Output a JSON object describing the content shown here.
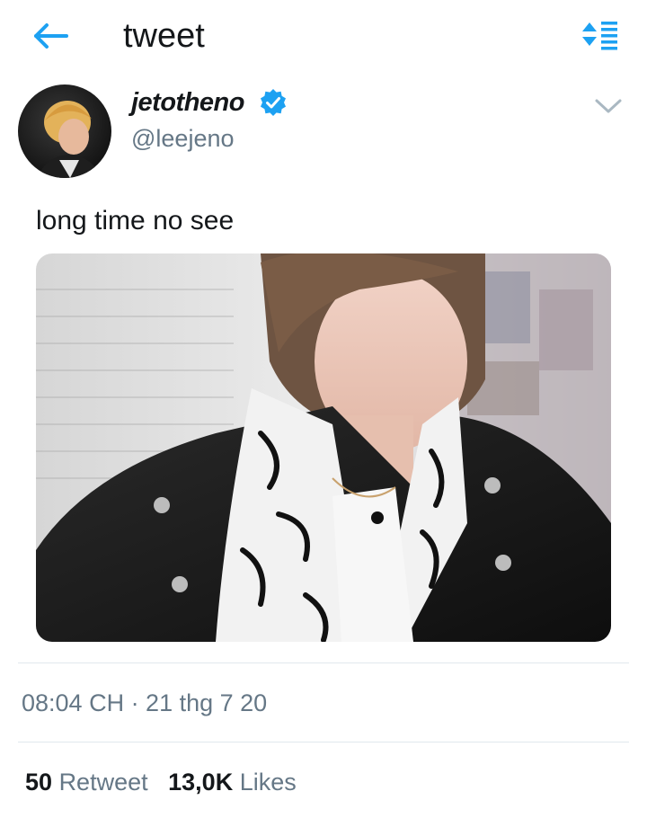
{
  "header": {
    "title": "tweet",
    "back_icon": "arrow-left-icon",
    "sort_icon": "sort-list-icon"
  },
  "tweet": {
    "author": {
      "display_name": "jetotheno",
      "handle": "@leejeno",
      "verified": true
    },
    "text": "long time no see",
    "timestamp": "08:04 CH · 21 thg 7 20",
    "stats": {
      "retweets_count": "50",
      "retweets_label": "Retweet",
      "likes_count": "13,0K",
      "likes_label": "Likes"
    }
  },
  "colors": {
    "accent": "#1da1f2",
    "text": "#14171a",
    "secondary": "#657786",
    "divider": "#e1e8ed"
  }
}
